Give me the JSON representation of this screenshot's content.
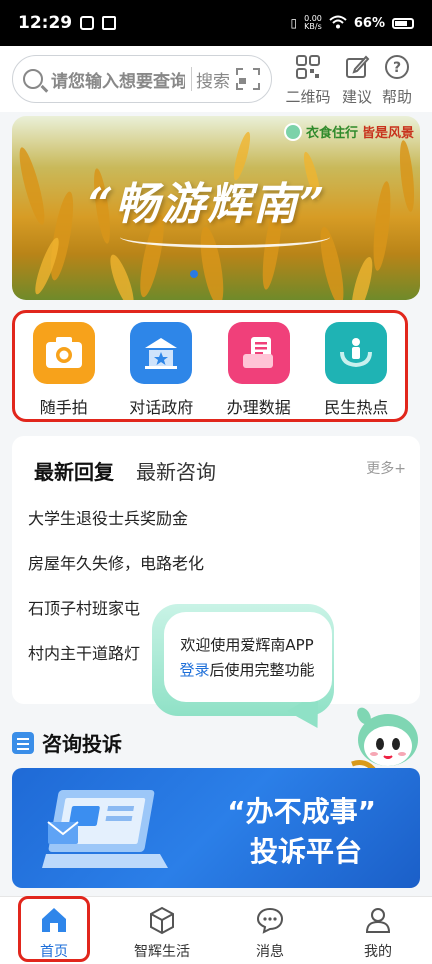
{
  "status_bar": {
    "time": "12:29",
    "net_speed_value": "0.00",
    "net_speed_unit": "KB/s",
    "battery": "66%"
  },
  "header": {
    "search_placeholder": "请您输入想要查询",
    "search_button": "搜索",
    "tools": [
      {
        "label": "二维码",
        "icon": "qrcode-icon"
      },
      {
        "label": "建议",
        "icon": "edit-icon"
      },
      {
        "label": "帮助",
        "icon": "help-icon"
      }
    ]
  },
  "banner": {
    "slogan_left": "衣食住行",
    "slogan_right": "皆是风景",
    "title": "“畅游辉南”",
    "active_dot": 0,
    "dot_count": 1
  },
  "quick_actions": [
    {
      "label": "随手拍",
      "icon": "camera-icon",
      "color": "#f7a21b"
    },
    {
      "label": "对话政府",
      "icon": "government-icon",
      "color": "#2e86e8"
    },
    {
      "label": "办理数据",
      "icon": "data-icon",
      "color": "#f0407a"
    },
    {
      "label": "民生热点",
      "icon": "people-icon",
      "color": "#1fb3b4"
    }
  ],
  "news": {
    "tabs": [
      {
        "label": "最新回复",
        "active": true
      },
      {
        "label": "最新咨询",
        "active": false
      }
    ],
    "more": "更多+",
    "items": [
      "大学生退役士兵奖励金",
      "房屋年久失修，电路老化",
      "石顶子村班家屯",
      "村内主干道路灯"
    ]
  },
  "login_bubble": {
    "line1": "欢迎使用爱辉南APP",
    "login": "登录",
    "line2_rest": "后使用完整功能"
  },
  "complaint": {
    "section_title": "咨询投诉",
    "line1": "“办不成事”",
    "line2": "投诉平台"
  },
  "tab_bar": [
    {
      "label": "首页",
      "icon": "home-icon",
      "active": true
    },
    {
      "label": "智辉生活",
      "icon": "box-icon",
      "active": false
    },
    {
      "label": "消息",
      "icon": "message-icon",
      "active": false
    },
    {
      "label": "我的",
      "icon": "user-icon",
      "active": false
    }
  ],
  "colors": {
    "accent": "#1e6fd9",
    "highlight_outline": "#e1261c"
  }
}
